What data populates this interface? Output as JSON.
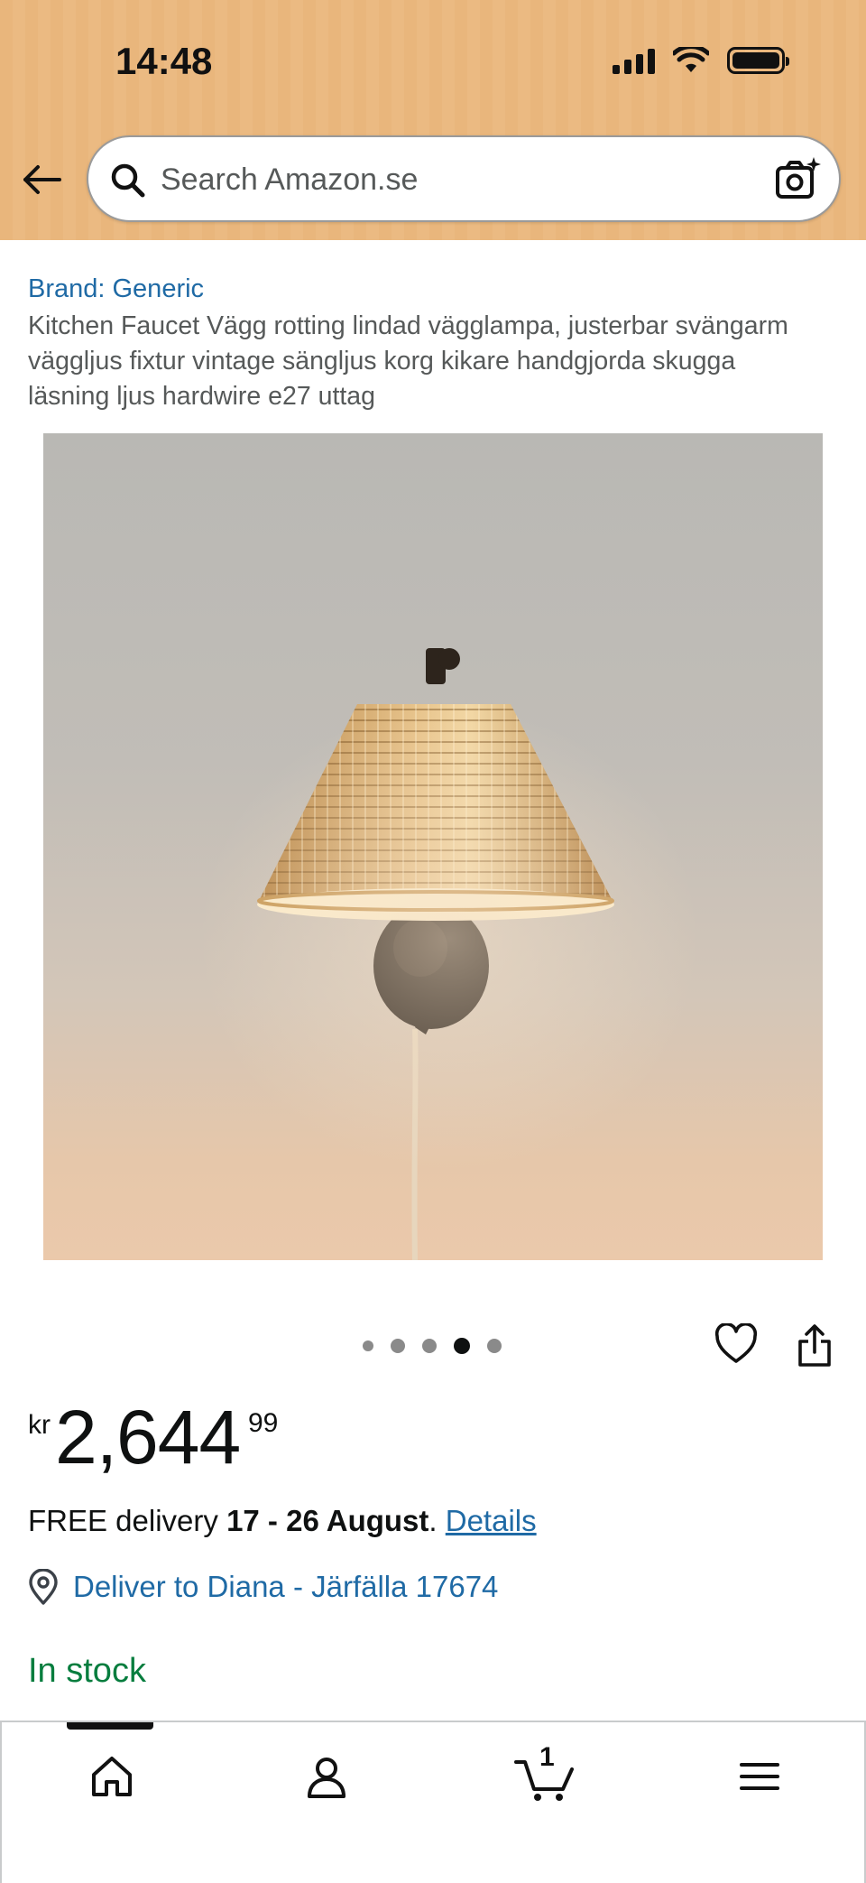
{
  "status_bar": {
    "time": "14:48"
  },
  "search": {
    "placeholder": "Search Amazon.se"
  },
  "product": {
    "brand": "Brand: Generic",
    "title": "Kitchen Faucet Vägg rotting lindad vägglampa, justerbar svängarm väggljus fixtur vintage sängljus korg kikare handgjorda skugga läsning ljus hardwire e27 uttag",
    "image_alt": "rattan wall lamp",
    "carousel": {
      "total": 5,
      "active": 4
    }
  },
  "price": {
    "currency": "kr",
    "whole": "2,644",
    "fraction": "99"
  },
  "delivery": {
    "prefix": "FREE delivery ",
    "dates": "17 - 26 August",
    "suffix": ". ",
    "details_link": "Details",
    "deliver_to": "Deliver to Diana - Järfälla 17674"
  },
  "availability": "In stock",
  "bottom_nav": {
    "items": [
      "home-icon",
      "account-icon",
      "cart-icon",
      "menu-icon"
    ],
    "cart_count": "1"
  },
  "colors": {
    "header_bg": "#e9b67c",
    "link": "#1f6aa5",
    "in_stock": "#067d3e"
  }
}
